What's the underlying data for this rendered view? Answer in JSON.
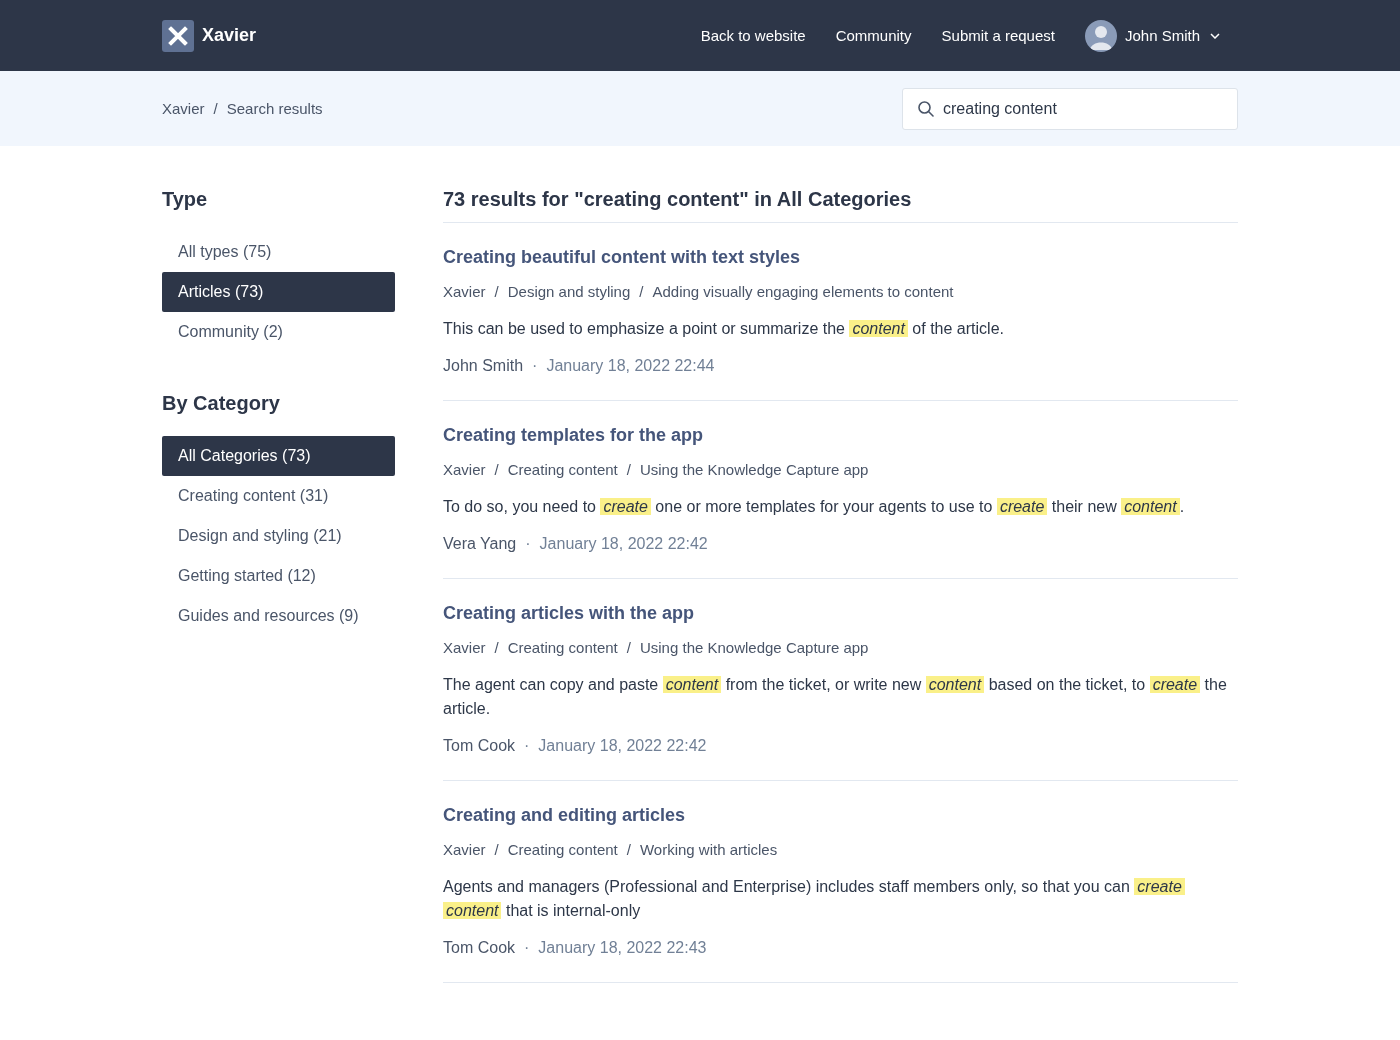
{
  "header": {
    "brand": "Xavier",
    "nav": [
      {
        "label": "Back to website"
      },
      {
        "label": "Community"
      },
      {
        "label": "Submit a request"
      }
    ],
    "user": {
      "name": "John Smith"
    }
  },
  "subheader": {
    "breadcrumb": [
      "Xavier",
      "Search results"
    ],
    "separator": "/",
    "search": {
      "value": "creating content"
    }
  },
  "sidebar": {
    "sections": [
      {
        "title": "Type",
        "items": [
          {
            "label": "All types (75)",
            "selected": false
          },
          {
            "label": "Articles (73)",
            "selected": true
          },
          {
            "label": "Community (2)",
            "selected": false
          }
        ]
      },
      {
        "title": "By Category",
        "items": [
          {
            "label": "All Categories (73)",
            "selected": true
          },
          {
            "label": "Creating content (31)",
            "selected": false
          },
          {
            "label": "Design and styling (21)",
            "selected": false
          },
          {
            "label": "Getting started (12)",
            "selected": false
          },
          {
            "label": "Guides and resources (9)",
            "selected": false
          }
        ]
      }
    ]
  },
  "results": {
    "heading": "73 results for \"creating content\" in All Categories",
    "meta_separator": "·",
    "path_separator": "/",
    "items": [
      {
        "title": "Creating beautiful content with text styles",
        "path": [
          "Xavier",
          "Design and styling",
          "Adding visually engaging elements to content"
        ],
        "snippet": "This can be used to emphasize a point or summarize the *content* of the article.",
        "author": "John Smith",
        "date": "January 18, 2022 22:44"
      },
      {
        "title": "Creating templates for the app",
        "path": [
          "Xavier",
          "Creating content",
          "Using the Knowledge Capture app"
        ],
        "snippet": "To do so, you need to *create* one or more templates for your agents to use to *create* their new *content*.",
        "author": "Vera Yang",
        "date": "January 18, 2022 22:42"
      },
      {
        "title": "Creating articles with the app",
        "path": [
          "Xavier",
          "Creating content",
          "Using the Knowledge Capture app"
        ],
        "snippet": "The agent can copy and paste *content* from the ticket, or write new *content* based on the ticket, to *create* the article.",
        "author": "Tom Cook",
        "date": "January 18, 2022 22:42"
      },
      {
        "title": "Creating and editing articles",
        "path": [
          "Xavier",
          "Creating content",
          "Working with articles"
        ],
        "snippet": "Agents and managers (Professional and Enterprise) includes staff members only, so that you can *create* *content* that is internal-only",
        "author": "Tom Cook",
        "date": "January 18, 2022 22:43"
      }
    ]
  }
}
